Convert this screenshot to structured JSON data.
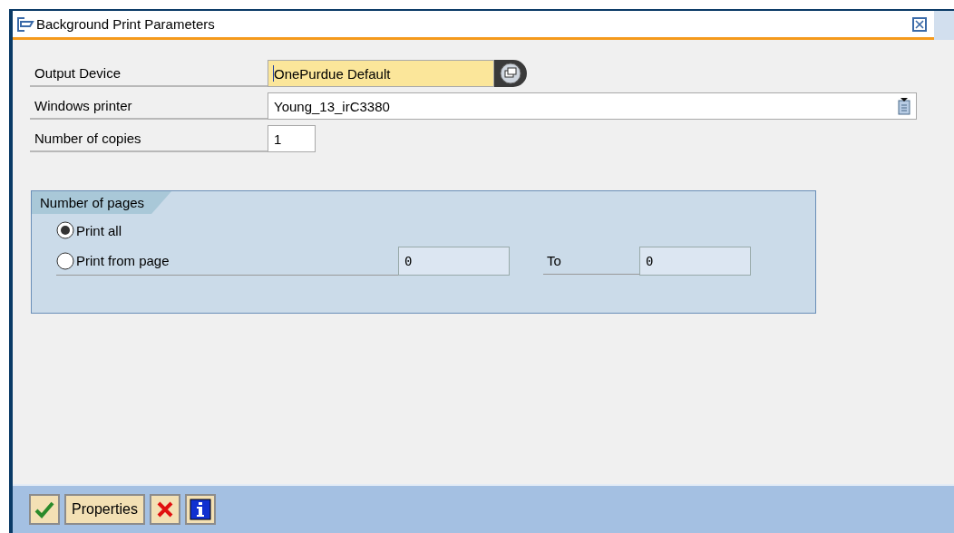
{
  "window": {
    "title": "Background Print Parameters"
  },
  "fields": [
    {
      "label": "Output Device",
      "value": "OnePurdue Default",
      "kind": "device",
      "focused": true
    },
    {
      "label": "Windows printer",
      "value": "Young_13_irC3380",
      "kind": "dropdown",
      "focused": false
    },
    {
      "label": "Number of copies",
      "value": "1",
      "kind": "short",
      "focused": false
    }
  ],
  "pages_group": {
    "title": "Number of pages",
    "options": [
      {
        "label": "Print all",
        "selected": true
      },
      {
        "label": "Print from page",
        "selected": false
      }
    ],
    "from_value": "0",
    "to_label": "To",
    "to_value": "0"
  },
  "buttons": [
    {
      "kind": "confirm"
    },
    {
      "kind": "text",
      "label": "Properties"
    },
    {
      "kind": "cancel"
    },
    {
      "kind": "info"
    }
  ]
}
